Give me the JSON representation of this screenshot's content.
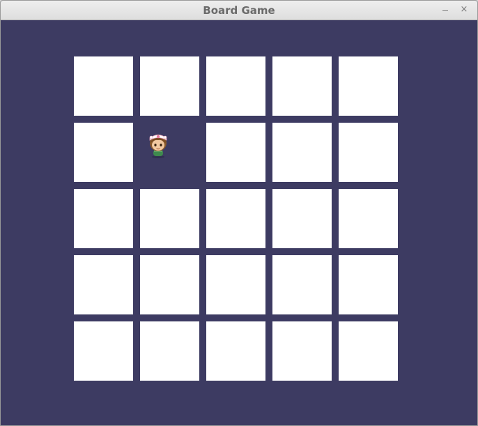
{
  "window": {
    "title": "Board Game",
    "minimize_icon": "minimize-icon",
    "close_icon": "close-icon",
    "close_glyph": "×"
  },
  "colors": {
    "background": "#3d3b62",
    "tile": "#ffffff",
    "titlebar": "#e6e6e6"
  },
  "board": {
    "rows": 5,
    "cols": 5,
    "cells": [
      [
        "hidden",
        "hidden",
        "hidden",
        "hidden",
        "hidden"
      ],
      [
        "hidden",
        "revealed",
        "hidden",
        "hidden",
        "hidden"
      ],
      [
        "hidden",
        "hidden",
        "hidden",
        "hidden",
        "hidden"
      ],
      [
        "hidden",
        "hidden",
        "hidden",
        "hidden",
        "hidden"
      ],
      [
        "hidden",
        "hidden",
        "hidden",
        "hidden",
        "hidden"
      ]
    ],
    "piece": {
      "icon": "player-character-icon",
      "row": 1,
      "col": 1
    }
  }
}
